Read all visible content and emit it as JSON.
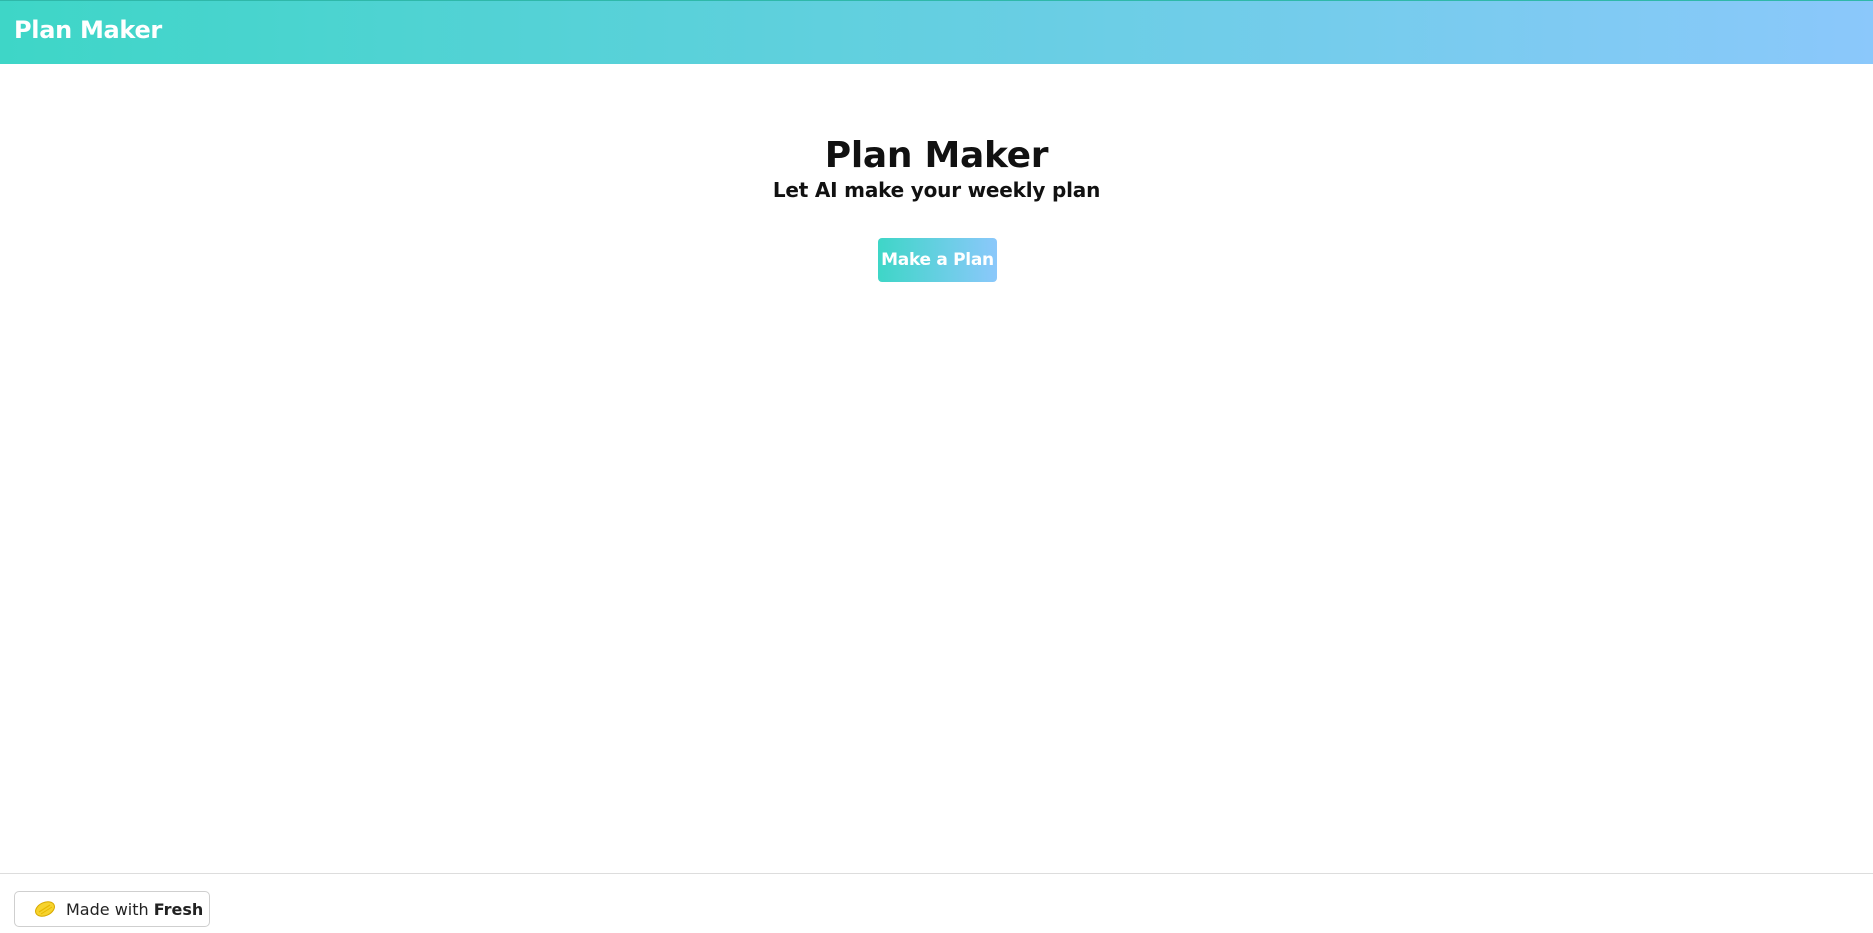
{
  "header": {
    "title": "Plan Maker"
  },
  "hero": {
    "title": "Plan Maker",
    "subtitle": "Let AI make your weekly plan",
    "button_label": "Make a Plan"
  },
  "footer": {
    "badge_prefix": "Made with ",
    "badge_brand": "Fresh",
    "badge_icon": "lemon-icon"
  },
  "colors": {
    "gradient_start": "#3ed6c7",
    "gradient_end": "#8bc8fb",
    "lemon": "#f6d32d"
  }
}
